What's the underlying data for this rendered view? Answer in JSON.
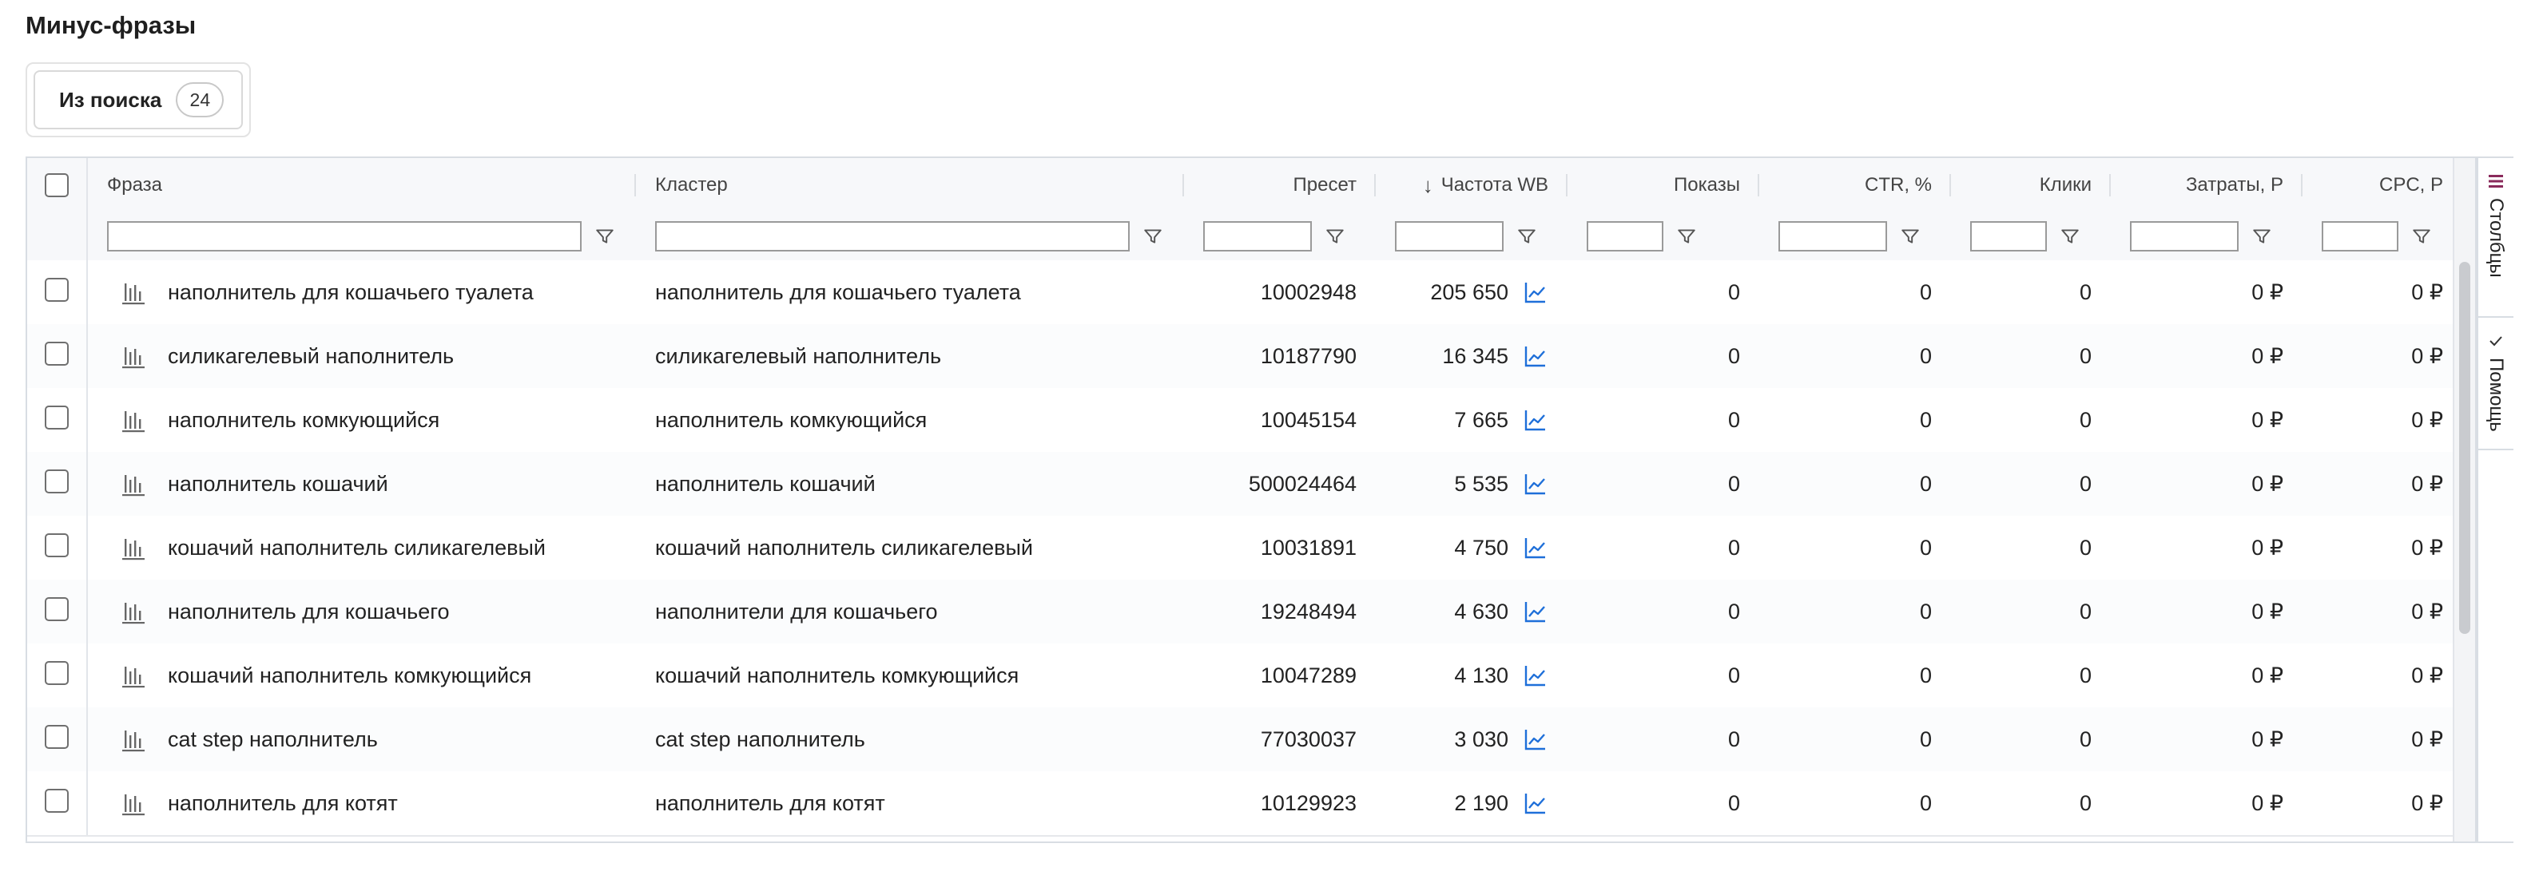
{
  "page_title": "Минус-фразы",
  "tabs": [
    {
      "label": "Из поиска",
      "count": "24"
    }
  ],
  "columns": {
    "phrase": "Фраза",
    "cluster": "Кластер",
    "preset": "Пресет",
    "frequency": "Частота WB",
    "frequency_sort": "↓",
    "impressions": "Показы",
    "ctr": "CTR, %",
    "clicks": "Клики",
    "costs": "Затраты, Р",
    "cpc": "CPC, Р"
  },
  "rows": [
    {
      "phrase": "наполнитель для кошачьего туалета",
      "cluster": "наполнитель для кошачьего туалета",
      "preset": "10002948",
      "frequency": "205 650",
      "impressions": "0",
      "ctr": "0",
      "clicks": "0",
      "costs": "0 ₽",
      "cpc": "0 ₽"
    },
    {
      "phrase": "силикагелевый наполнитель",
      "cluster": "силикагелевый наполнитель",
      "preset": "10187790",
      "frequency": "16 345",
      "impressions": "0",
      "ctr": "0",
      "clicks": "0",
      "costs": "0 ₽",
      "cpc": "0 ₽"
    },
    {
      "phrase": "наполнитель комкующийся",
      "cluster": "наполнитель комкующийся",
      "preset": "10045154",
      "frequency": "7 665",
      "impressions": "0",
      "ctr": "0",
      "clicks": "0",
      "costs": "0 ₽",
      "cpc": "0 ₽"
    },
    {
      "phrase": "наполнитель кошачий",
      "cluster": "наполнитель кошачий",
      "preset": "500024464",
      "frequency": "5 535",
      "impressions": "0",
      "ctr": "0",
      "clicks": "0",
      "costs": "0 ₽",
      "cpc": "0 ₽"
    },
    {
      "phrase": "кошачий наполнитель силикагелевый",
      "cluster": "кошачий наполнитель силикагелевый",
      "preset": "10031891",
      "frequency": "4 750",
      "impressions": "0",
      "ctr": "0",
      "clicks": "0",
      "costs": "0 ₽",
      "cpc": "0 ₽"
    },
    {
      "phrase": "наполнитель для кошачьего",
      "cluster": "наполнители для кошачьего",
      "preset": "19248494",
      "frequency": "4 630",
      "impressions": "0",
      "ctr": "0",
      "clicks": "0",
      "costs": "0 ₽",
      "cpc": "0 ₽"
    },
    {
      "phrase": "кошачий наполнитель комкующийся",
      "cluster": "кошачий наполнитель комкующийся",
      "preset": "10047289",
      "frequency": "4 130",
      "impressions": "0",
      "ctr": "0",
      "clicks": "0",
      "costs": "0 ₽",
      "cpc": "0 ₽"
    },
    {
      "phrase": "cat step наполнитель",
      "cluster": "cat step наполнитель",
      "preset": "77030037",
      "frequency": "3 030",
      "impressions": "0",
      "ctr": "0",
      "clicks": "0",
      "costs": "0 ₽",
      "cpc": "0 ₽"
    },
    {
      "phrase": "наполнитель для котят",
      "cluster": "наполнитель для котят",
      "preset": "10129923",
      "frequency": "2 190",
      "impressions": "0",
      "ctr": "0",
      "clicks": "0",
      "costs": "0 ₽",
      "cpc": "0 ₽"
    }
  ],
  "side_panel": {
    "columns_label": "Столбцы",
    "help_label": "Помощь"
  },
  "icons": {
    "row_chart": "bar-chart-icon",
    "frequency_trend": "trend-chart-icon",
    "filter": "filter-icon",
    "columns": "columns-icon",
    "help": "check-icon"
  },
  "colors": {
    "trend_icon": "#1e6fd9",
    "columns_icon": "#8a2a5b",
    "text": "#222222",
    "header_bg": "#f7f8fa"
  }
}
